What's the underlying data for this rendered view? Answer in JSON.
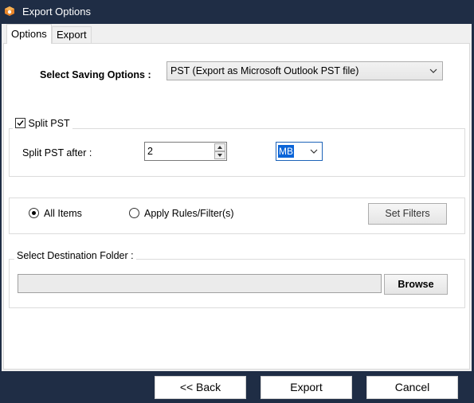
{
  "window": {
    "title": "Export Options"
  },
  "tabs": [
    {
      "label": "Options",
      "active": true
    },
    {
      "label": "Export",
      "active": false
    }
  ],
  "saving": {
    "label": "Select Saving Options :",
    "selected": "PST (Export as Microsoft Outlook PST file)"
  },
  "split": {
    "checkbox_label": "Split PST",
    "checked": true,
    "after_label": "Split PST after :",
    "size_value": "2",
    "unit_selected": "MB"
  },
  "items": {
    "all_items_label": "All Items",
    "all_items_selected": true,
    "apply_rules_label": "Apply Rules/Filter(s)",
    "apply_rules_selected": false,
    "set_filters_label": "Set Filters"
  },
  "destination": {
    "label": "Select Destination Folder :",
    "path_value": "",
    "browse_label": "Browse"
  },
  "footer": {
    "back_label": "<< Back",
    "export_label": "Export",
    "cancel_label": "Cancel"
  },
  "colors": {
    "titlebar": "#1f2d45",
    "selection": "#0a64d8",
    "icon_orange": "#e8852a"
  }
}
